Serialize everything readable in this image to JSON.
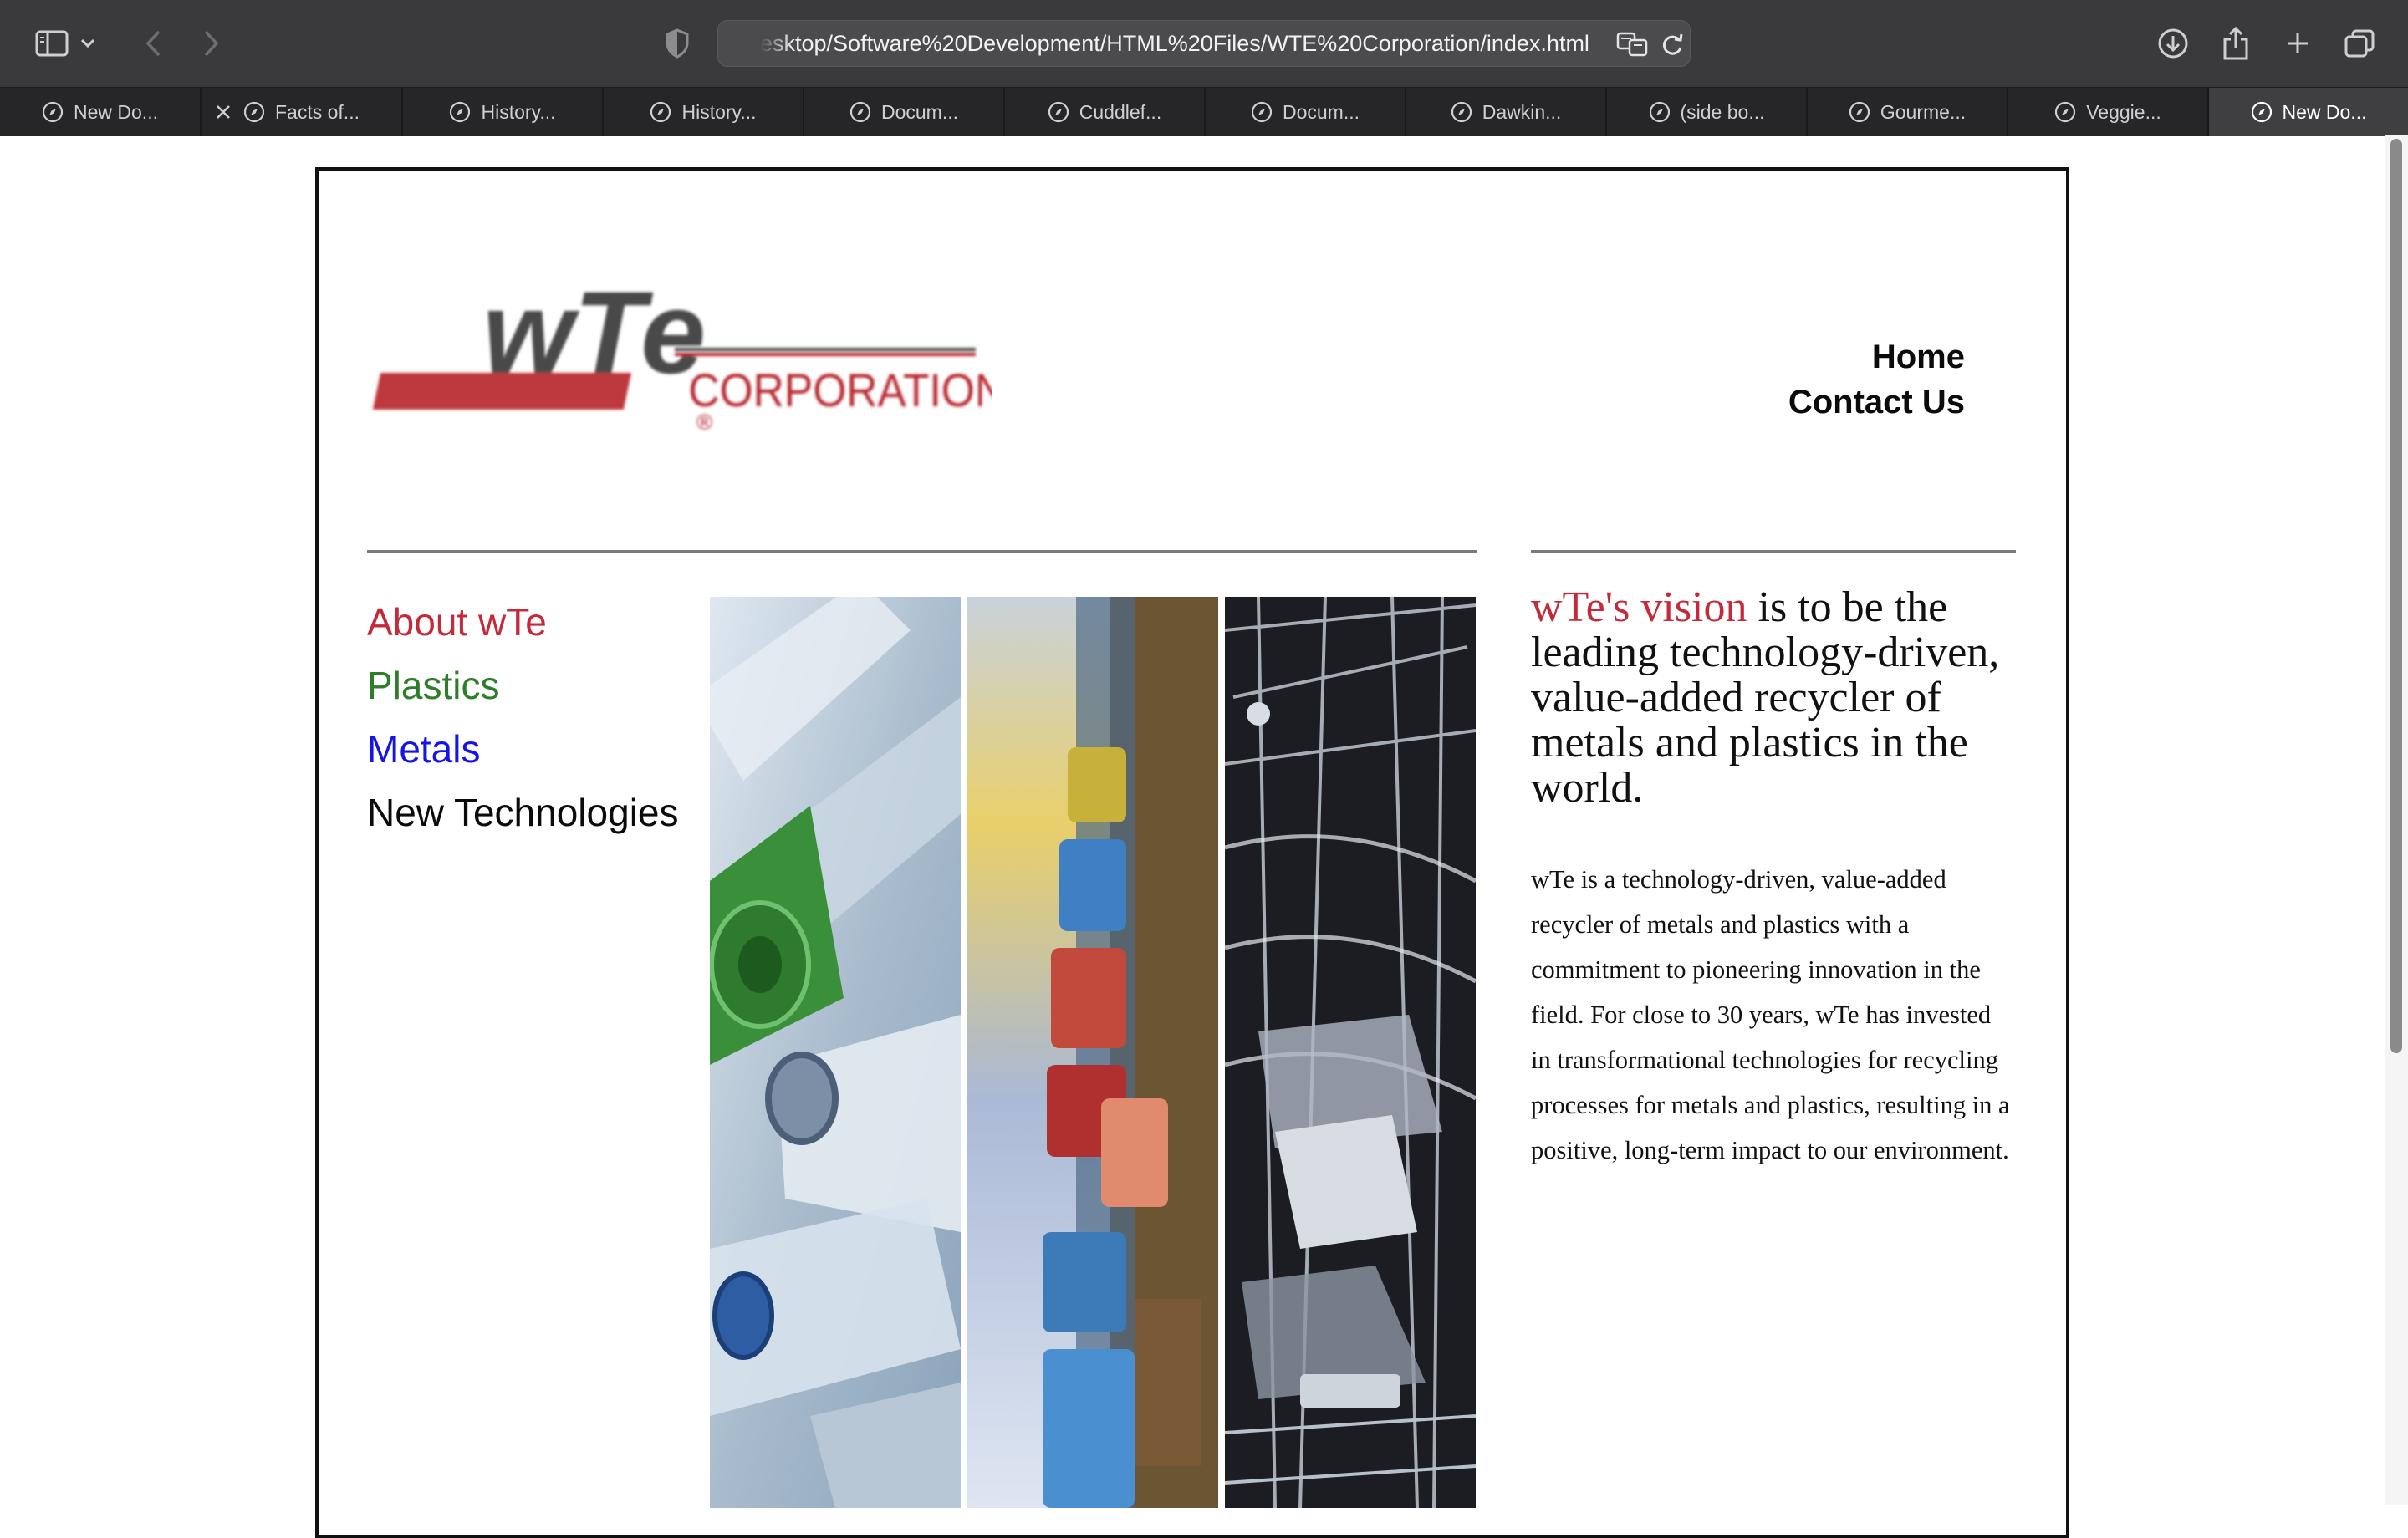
{
  "browser": {
    "url": "esktop/Software%20Development/HTML%20Files/WTE%20Corporation/index.html",
    "tabs": [
      {
        "label": "New Do..."
      },
      {
        "label": "Facts of..."
      },
      {
        "label": "History..."
      },
      {
        "label": "History..."
      },
      {
        "label": "Docum..."
      },
      {
        "label": "Cuddlef..."
      },
      {
        "label": "Docum..."
      },
      {
        "label": "Dawkin..."
      },
      {
        "label": "(side bo..."
      },
      {
        "label": "Gourme..."
      },
      {
        "label": "Veggie..."
      },
      {
        "label": "New Do..."
      }
    ]
  },
  "page": {
    "logo": {
      "text_main": "wTe",
      "text_sub": "CORPORATION",
      "mark": "®"
    },
    "nav_top": {
      "home": "Home",
      "contact": "Contact Us"
    },
    "side_nav": [
      {
        "label": "About wTe",
        "color": "#c42b3a"
      },
      {
        "label": "Plastics",
        "color": "#2f7d2a"
      },
      {
        "label": "Metals",
        "color": "#1515e6"
      },
      {
        "label": "New Technologies",
        "color": "#0b0b0b"
      }
    ],
    "vision": {
      "highlight": "wTe's vision",
      "rest": " is to be the leading technology-driven, value-added recycler of metals and plastics in the world."
    },
    "about_text": "wTe is a technology-driven, value-added recycler of metals and plastics with a commitment to pioneering innovation in the field. For close to 30 years, wTe has invested in transformational technologies for recycling processes for metals and plastics, resulting in a positive, long-term impact to our environment."
  },
  "colors": {
    "brand_red": "#c42b3a",
    "plastics_green": "#2f7d2a",
    "metals_blue": "#1515e6"
  }
}
